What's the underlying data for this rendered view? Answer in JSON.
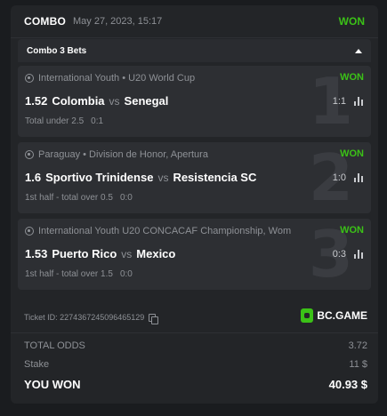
{
  "header": {
    "combo_label": "COMBO",
    "date": "May 27, 2023, 15:17",
    "status": "WON"
  },
  "bets_bar": {
    "title": "Combo 3 Bets"
  },
  "bets": [
    {
      "league": "International Youth • U20 World Cup",
      "status": "WON",
      "odds": "1.52",
      "home": "Colombia",
      "vs": "vs",
      "away": "Senegal",
      "score": "1:1",
      "market": "Total under 2.5",
      "selection": "0:1",
      "number": "1"
    },
    {
      "league": "Paraguay • Division de Honor, Apertura",
      "status": "WON",
      "odds": "1.6",
      "home": "Sportivo Trinidense",
      "vs": "vs",
      "away": "Resistencia SC",
      "score": "1:0",
      "market": "1st half - total over 0.5",
      "selection": "0:0",
      "number": "2"
    },
    {
      "league": "International Youth U20 CONCACAF Championship, Wom",
      "status": "WON",
      "odds": "1.53",
      "home": "Puerto Rico",
      "vs": "vs",
      "away": "Mexico",
      "score": "0:3",
      "market": "1st half - total over 1.5",
      "selection": "0:0",
      "number": "3"
    }
  ],
  "ticket": {
    "label": "Ticket ID: 2274367245096465129"
  },
  "brand": {
    "name": "BC.GAME"
  },
  "summary": {
    "total_odds_label": "TOTAL ODDS",
    "total_odds_value": "3.72",
    "stake_label": "Stake",
    "stake_value": "11 $",
    "won_label": "YOU WON",
    "won_value": "40.93 $"
  },
  "colors": {
    "accent": "#3bc117",
    "background": "#1a1c1f",
    "card": "#232528"
  },
  "icons": {
    "ball": "soccer-ball-icon",
    "stats": "stats-icon",
    "copy": "copy-icon",
    "chevron": "chevron-up-icon"
  }
}
